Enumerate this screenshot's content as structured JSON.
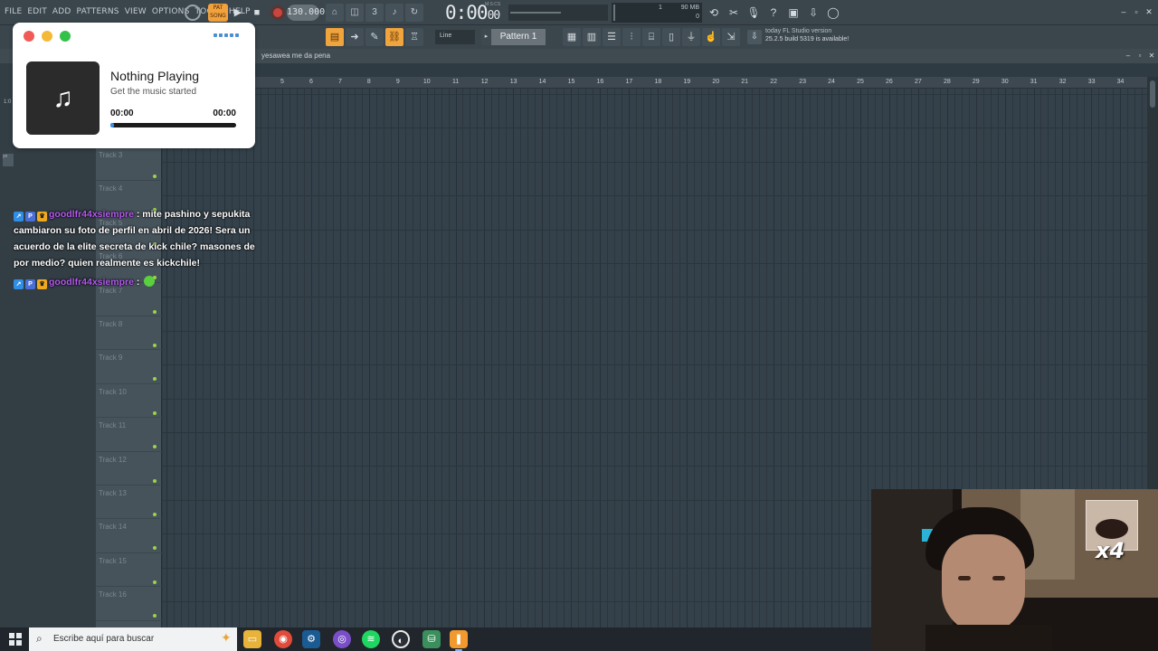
{
  "menu": [
    "FILE",
    "EDIT",
    "ADD",
    "PATTERNS",
    "VIEW",
    "OPTIONS",
    "TOOLS",
    "HELP"
  ],
  "transport": {
    "pat_song_label": "PAT SONG",
    "play_glyph": "▶",
    "stop_glyph": "■",
    "tempo": "130.000",
    "time_main": "0:00",
    "time_sub": "00",
    "time_unit": "M:S:CS"
  },
  "cpu_panel": {
    "cpu_value": "1",
    "memory": "90 MB",
    "polyphony": "0"
  },
  "toolbar2": {
    "snap_mode": "Line",
    "pattern_name": "Pattern 1",
    "news_line1": "today  FL Studio version",
    "news_line2": "25.2.5 build 5319 is available!"
  },
  "playlist": {
    "breadcrumb": "yesawea me da pena",
    "left_label_1": "1:0",
    "left_label_2": "ye",
    "ruler_numbers": [
      "5",
      "6",
      "7",
      "8",
      "9",
      "10",
      "11",
      "12",
      "13",
      "14",
      "15",
      "16",
      "17",
      "18",
      "19",
      "20",
      "21",
      "22",
      "23",
      "24",
      "25",
      "26",
      "27",
      "28",
      "29",
      "30",
      "31",
      "32",
      "33",
      "34"
    ],
    "tracks": [
      "Track 3",
      "Track 4",
      "Track 5",
      "Track 6",
      "Track 7",
      "Track 8",
      "Track 9",
      "Track 10",
      "Track 11",
      "Track 12",
      "Track 13",
      "Track 14",
      "Track 15",
      "Track 16"
    ]
  },
  "now_playing": {
    "title": "Nothing Playing",
    "subtitle": "Get the music started",
    "time_current": "00:00",
    "time_total": "00:00",
    "progress": 0.03,
    "art_glyph": "♫"
  },
  "chat": {
    "messages": [
      {
        "user": "goodlfr44xsiempre",
        "separator": " : ",
        "text": "mite pashino y sepukita cambiaron su foto de perfil en abril de 2026! Sera un acuerdo de la elite secreta de kick chile? masones de por medio? quien realmente es kickchile!"
      },
      {
        "user": "goodlfr44xsiempre",
        "separator": " : ",
        "text": ""
      }
    ]
  },
  "webcam": {
    "overlay_text": "x4"
  },
  "taskbar": {
    "search_placeholder": "Escribe aquí para buscar"
  },
  "colors": {
    "accent_orange": "#f0a43d",
    "chat_username": "#b55bf0",
    "track_dot": "#9bd34a",
    "grid_bg": "#34414a"
  }
}
